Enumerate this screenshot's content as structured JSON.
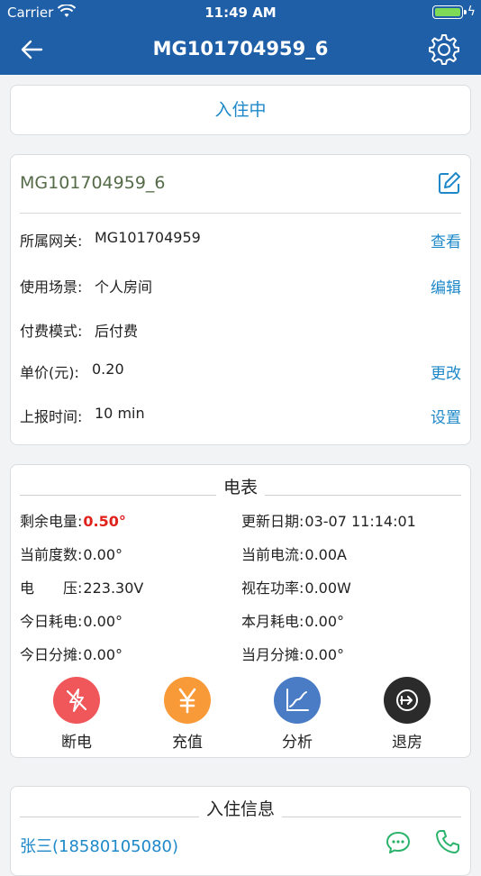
{
  "status_bar": {
    "carrier": "Carrier",
    "time": "11:49 AM"
  },
  "nav": {
    "title": "MG101704959_6"
  },
  "status": {
    "text": "入住中"
  },
  "device": {
    "id": "MG101704959_6",
    "rows": [
      {
        "label": "所属网关:",
        "value": "MG101704959",
        "action": "查看"
      },
      {
        "label": "使用场景:",
        "value": "个人房间",
        "action": "编辑"
      },
      {
        "label": "付费模式:",
        "value": "后付费",
        "action": ""
      },
      {
        "label": "单价(元):",
        "value": "0.20",
        "action": "更改"
      },
      {
        "label": "上报时间:",
        "value": "10 min",
        "action": "设置"
      }
    ]
  },
  "meter": {
    "title": "电表",
    "items": [
      {
        "label": "剩余电量:",
        "value": "0.50°"
      },
      {
        "label": "更新日期:",
        "value": "03-07 11:14:01"
      },
      {
        "label": "当前度数:",
        "value": "0.00°"
      },
      {
        "label": "当前电流:",
        "value": "0.00A"
      },
      {
        "label": "电　　压:",
        "value": "223.30V"
      },
      {
        "label": "视在功率:",
        "value": "0.00W"
      },
      {
        "label": "今日耗电:",
        "value": "0.00°"
      },
      {
        "label": "本月耗电:",
        "value": "0.00°"
      },
      {
        "label": "今日分摊:",
        "value": "0.00°"
      },
      {
        "label": "当月分摊:",
        "value": "0.00°"
      }
    ],
    "actions": [
      {
        "label": "断电",
        "icon": "power-off-icon",
        "color": "#f0575a"
      },
      {
        "label": "充值",
        "icon": "yuan-icon",
        "color": "#f89a38"
      },
      {
        "label": "分析",
        "icon": "chart-icon",
        "color": "#4a7cc5"
      },
      {
        "label": "退房",
        "icon": "checkout-icon",
        "color": "#2b2b2b"
      }
    ]
  },
  "checkin": {
    "title": "入住信息",
    "tenant": "张三(18580105080)"
  },
  "colors": {
    "primary": "#1e5fa8",
    "link": "#1e88c9",
    "alert": "#e0221c"
  }
}
